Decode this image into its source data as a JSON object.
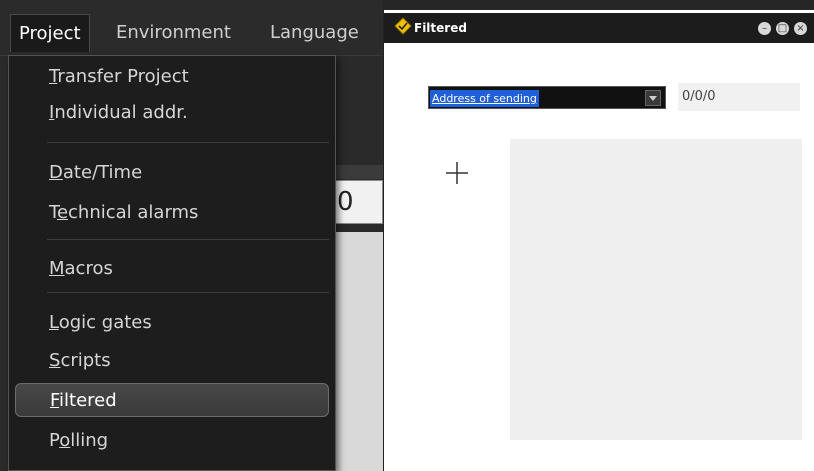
{
  "menubar": {
    "items": [
      "Project",
      "Environment",
      "Language"
    ],
    "active_index": 0
  },
  "background": {
    "field_value": "0"
  },
  "dropdown": {
    "items": [
      {
        "pre": "",
        "u": "T",
        "post": "ransfer Project"
      },
      {
        "pre": "",
        "u": "I",
        "post": "ndividual addr."
      },
      {
        "pre": "",
        "u": "D",
        "post": "ate/Time"
      },
      {
        "pre": "T",
        "u": "e",
        "post": "chnical alarms"
      },
      {
        "pre": "",
        "u": "M",
        "post": "acros"
      },
      {
        "pre": "",
        "u": "L",
        "post": "ogic gates"
      },
      {
        "pre": "",
        "u": "S",
        "post": "cripts"
      },
      {
        "pre": "",
        "u": "F",
        "post": "iltered"
      },
      {
        "pre": "P",
        "u": "o",
        "post": "lling"
      }
    ],
    "selected_index": 7
  },
  "dialog": {
    "title": "Filtered",
    "title_icon": "yellow-diamond-icon",
    "window_buttons": [
      "minimize-icon",
      "maximize-icon",
      "close-icon"
    ],
    "address_select": {
      "value": "Address of sending"
    },
    "address_value": "0/0/0",
    "add_icon": "plus-icon"
  },
  "colors": {
    "menu_bg": "#1d1d1d",
    "selection_blue": "#1f5fd8",
    "title_icon_yellow": "#f2c200"
  }
}
